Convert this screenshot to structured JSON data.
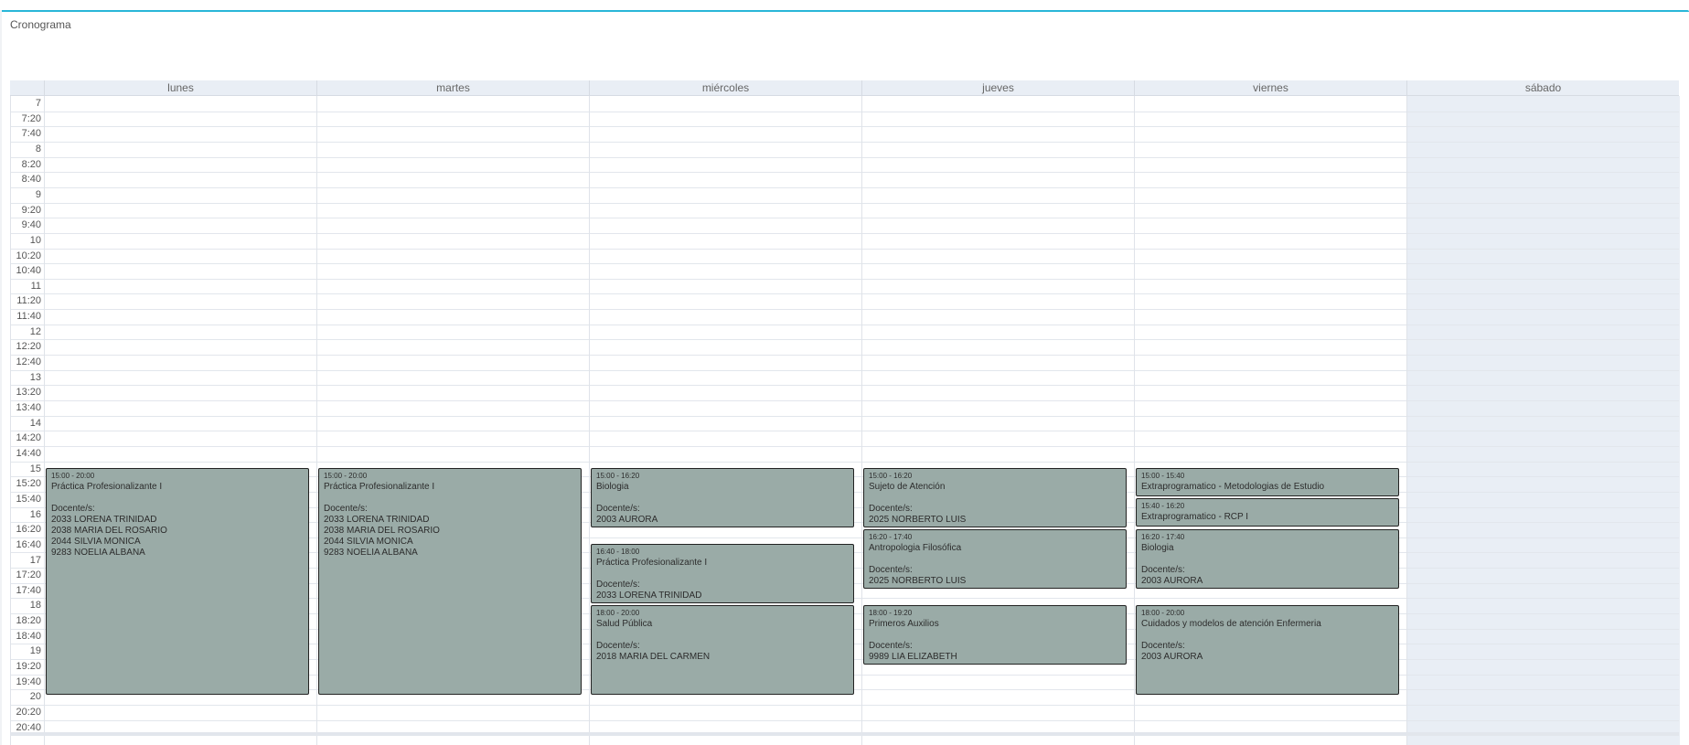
{
  "panel": {
    "title": "Cronograma",
    "accent_color": "#29b6d8"
  },
  "days": [
    "lunes",
    "martes",
    "miércoles",
    "jueves",
    "viernes",
    "sábado"
  ],
  "times": [
    "7",
    "7:20",
    "7:40",
    "8",
    "8:20",
    "8:40",
    "9",
    "9:20",
    "9:40",
    "10",
    "10:20",
    "10:40",
    "11",
    "11:20",
    "11:40",
    "12",
    "12:20",
    "12:40",
    "13",
    "13:20",
    "13:40",
    "14",
    "14:20",
    "14:40",
    "15",
    "15:20",
    "15:40",
    "16",
    "16:20",
    "16:40",
    "17",
    "17:20",
    "17:40",
    "18",
    "18:20",
    "18:40",
    "19",
    "19:20",
    "19:40",
    "20",
    "20:20",
    "20:40"
  ],
  "events": [
    {
      "day": 0,
      "time": "15:00 - 20:00",
      "title": "Práctica Profesionalizante I",
      "docentes_label": "Docente/s:",
      "docentes": [
        "2033 LORENA TRINIDAD",
        "2038 MARIA DEL ROSARIO",
        "2044 SILVIA MONICA",
        "9283 NOELIA ALBANA"
      ]
    },
    {
      "day": 1,
      "time": "15:00 - 20:00",
      "title": "Práctica Profesionalizante I",
      "docentes_label": "Docente/s:",
      "docentes": [
        "2033 LORENA TRINIDAD",
        "2038 MARIA DEL ROSARIO",
        "2044 SILVIA MONICA",
        "9283 NOELIA ALBANA"
      ]
    },
    {
      "day": 2,
      "time": "15:00 - 16:20",
      "title": "Biologia",
      "docentes_label": "Docente/s:",
      "docentes": [
        "2003 AURORA"
      ]
    },
    {
      "day": 2,
      "time": "16:40 - 18:00",
      "title": "Práctica Profesionalizante I",
      "docentes_label": "Docente/s:",
      "docentes": [
        "2033 LORENA TRINIDAD"
      ]
    },
    {
      "day": 2,
      "time": "18:00 - 20:00",
      "title": "Salud Pública",
      "docentes_label": "Docente/s:",
      "docentes": [
        "2018 MARIA DEL CARMEN"
      ]
    },
    {
      "day": 3,
      "time": "15:00 - 16:20",
      "title": "Sujeto de Atención",
      "docentes_label": "Docente/s:",
      "docentes": [
        "2025 NORBERTO LUIS"
      ]
    },
    {
      "day": 3,
      "time": "16:20 - 17:40",
      "title": "Antropologia Filosófica",
      "docentes_label": "Docente/s:",
      "docentes": [
        "2025 NORBERTO LUIS"
      ]
    },
    {
      "day": 3,
      "time": "18:00 - 19:20",
      "title": "Primeros Auxilios",
      "docentes_label": "Docente/s:",
      "docentes": [
        "9989 LIA ELIZABETH"
      ]
    },
    {
      "day": 4,
      "time": "15:00 - 15:40",
      "title": "Extraprogramatico - Metodologias de Estudio",
      "docentes_label": "",
      "docentes": []
    },
    {
      "day": 4,
      "time": "15:40 - 16:20",
      "title": "Extraprogramatico - RCP I",
      "docentes_label": "",
      "docentes": []
    },
    {
      "day": 4,
      "time": "16:20 - 17:40",
      "title": "Biologia",
      "docentes_label": "Docente/s:",
      "docentes": [
        "2003 AURORA"
      ]
    },
    {
      "day": 4,
      "time": "18:00 - 20:00",
      "title": "Cuidados y modelos de atención Enfermeria",
      "docentes_label": "Docente/s:",
      "docentes": [
        "2003 AURORA"
      ]
    }
  ],
  "event_color": "#9aaba7",
  "weekend_color": "#e9eef5"
}
